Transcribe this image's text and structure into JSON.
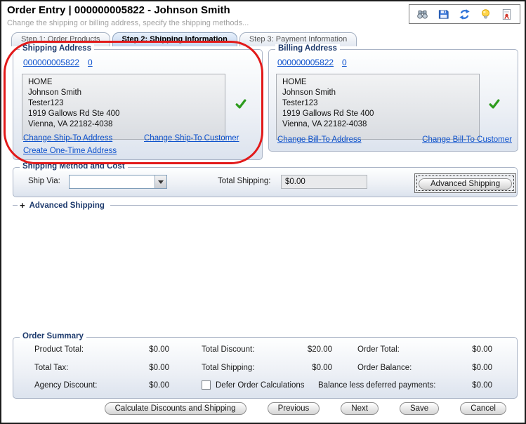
{
  "window": {
    "title": "Order Entry | 000000005822 - Johnson Smith",
    "subtitle": "Change the shipping or billing address, specify the shipping methods...",
    "toolbar_icons": [
      "find-icon",
      "save-icon",
      "refresh-icon",
      "hint-icon",
      "report-icon"
    ]
  },
  "tabs": [
    {
      "label": "Step 1: Order Products",
      "active": false
    },
    {
      "label": "Step 2: Shipping Information",
      "active": true
    },
    {
      "label": "Step 3: Payment Information",
      "active": false
    }
  ],
  "shipping_address": {
    "legend": "Shipping Address",
    "customer_link": "000000005822",
    "count_link": "0",
    "address_lines": [
      "HOME",
      "Johnson Smith",
      "Tester123",
      "1919 Gallows Rd Ste 400",
      "Vienna, VA 22182-4038"
    ],
    "verified": true,
    "change_address_link": "Change Ship-To Address",
    "change_customer_link": "Change Ship-To Customer",
    "create_one_time_link": "Create One-Time Address"
  },
  "billing_address": {
    "legend": "Billing Address",
    "customer_link": "000000005822",
    "count_link": "0",
    "address_lines": [
      "HOME",
      "Johnson Smith",
      "Tester123",
      "1919 Gallows Rd Ste 400",
      "Vienna, VA 22182-4038"
    ],
    "verified": true,
    "change_address_link": "Change Bill-To Address",
    "change_customer_link": "Change Bill-To Customer"
  },
  "shipping_method": {
    "legend": "Shipping Method and Cost",
    "ship_via_label": "Ship Via:",
    "ship_via_value": "",
    "total_shipping_label": "Total Shipping:",
    "total_shipping_value": "$0.00",
    "advanced_button_label": "Advanced Shipping"
  },
  "advanced_expander": {
    "symbol": "+",
    "label": "Advanced Shipping",
    "expanded": false
  },
  "order_summary": {
    "legend": "Order Summary",
    "product_total_label": "Product Total:",
    "product_total": "$0.00",
    "total_tax_label": "Total Tax:",
    "total_tax": "$0.00",
    "agency_discount_label": "Agency Discount:",
    "agency_discount": "$0.00",
    "total_discount_label": "Total Discount:",
    "total_discount": "$20.00",
    "total_shipping_label": "Total Shipping:",
    "total_shipping": "$0.00",
    "defer_checkbox_label": "Defer Order Calculations",
    "defer_checked": false,
    "order_total_label": "Order Total:",
    "order_total": "$0.00",
    "order_balance_label": "Order Balance:",
    "order_balance": "$0.00",
    "balance_less_label": "Balance less deferred payments:",
    "balance_less": "$0.00"
  },
  "footer_buttons": [
    "Calculate Discounts and Shipping",
    "Previous",
    "Next",
    "Save",
    "Cancel"
  ],
  "colors": {
    "legend_text": "#1d3a6d",
    "link_blue": "#0b50cc",
    "check_green": "#2e9c1e",
    "annotation_red": "#e21a1a",
    "active_tab_bg": "#c3d5ee"
  }
}
